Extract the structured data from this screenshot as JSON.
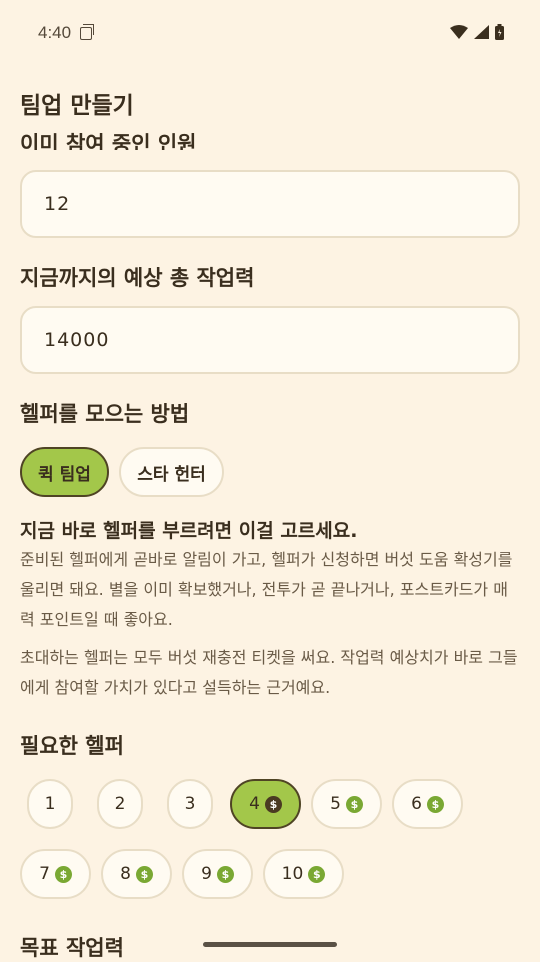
{
  "status": {
    "time": "4:40"
  },
  "title": "팀업 만들기",
  "participants": {
    "label": "이미 참여 중인 인원",
    "value": "12"
  },
  "power": {
    "label": "지금까지의 예상 총 작업력",
    "value": "14000"
  },
  "method": {
    "label": "헬퍼를 모으는 방법",
    "options": [
      "퀵 팀업",
      "스타 헌터"
    ],
    "selected": "퀵 팀업"
  },
  "description": {
    "heading": "지금 바로 헬퍼를 부르려면 이걸 고르세요.",
    "para1": "준비된 헬퍼에게 곧바로 알림이 가고, 헬퍼가 신청하면 버섯 도움 확성기를 울리면 돼요. 별을 이미 확보했거나, 전투가 곧 끝나거나, 포스트카드가 매력 포인트일 때 좋아요.",
    "para2": "초대하는 헬퍼는 모두 버섯 재충전 티켓을 써요. 작업력 예상치가 바로 그들에게 참여할 가치가 있다고 설득하는 근거예요."
  },
  "helpers": {
    "label": "필요한 헬퍼",
    "options": [
      "1",
      "2",
      "3",
      "4",
      "5",
      "6",
      "7",
      "8",
      "9",
      "10"
    ],
    "coin_symbol": "$",
    "selected": "4"
  },
  "target": {
    "label": "목표 작업력"
  },
  "colors": {
    "accent": "#A3C74A",
    "background": "#FDF3E3"
  }
}
